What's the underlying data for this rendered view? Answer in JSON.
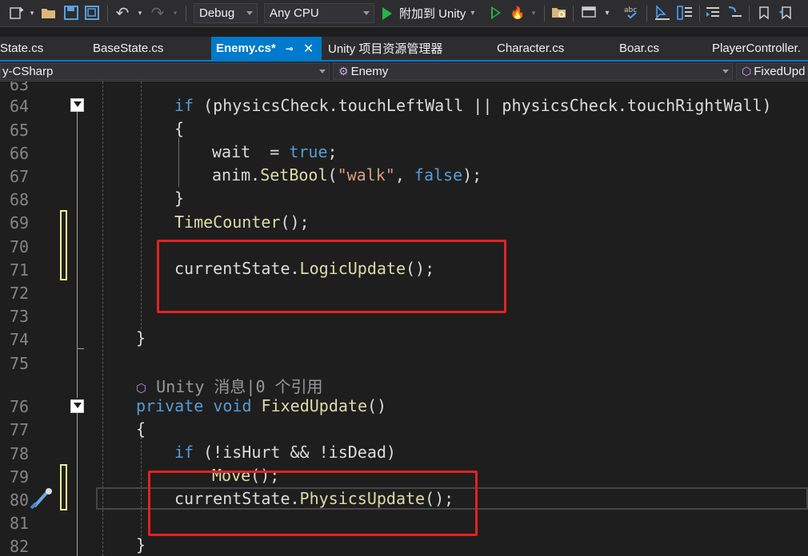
{
  "toolbar": {
    "config": "Debug",
    "platform": "Any CPU",
    "attach": "附加到 Unity"
  },
  "tabs": [
    {
      "label": "State.cs"
    },
    {
      "label": "BaseState.cs"
    },
    {
      "label": "Enemy.cs*",
      "active": true
    },
    {
      "label": "Unity 项目资源管理器"
    },
    {
      "label": "Character.cs"
    },
    {
      "label": "Boar.cs"
    },
    {
      "label": "PlayerController."
    }
  ],
  "nav": {
    "project": "y-CSharp",
    "class": "Enemy",
    "member": "FixedUpd"
  },
  "editor": {
    "line_numbers": [
      "63",
      "64",
      "65",
      "66",
      "67",
      "68",
      "69",
      "70",
      "71",
      "72",
      "73",
      "74",
      "75",
      "76",
      "77",
      "78",
      "79",
      "80",
      "81",
      "82"
    ],
    "codelens": "Unity 消息|0 个引用",
    "colors": {
      "keyword": "#569cd6",
      "method": "#dcdcaa",
      "string": "#d69d85",
      "highlight": "#e32222"
    }
  },
  "code": {
    "l64_if": "if",
    "l64_cond": " (physicsCheck.touchLeftWall || physicsCheck.touchRightWall)",
    "l65": "{",
    "l66_a": "wait  = ",
    "l66_b": "true",
    "l66_c": ";",
    "l67_a": "anim.",
    "l67_b": "SetBool",
    "l67_c": "(",
    "l67_d": "\"walk\"",
    "l67_e": ", ",
    "l67_f": "false",
    "l67_g": ");",
    "l68": "}",
    "l69_a": "TimeCounter",
    "l69_b": "();",
    "l71_a": "currentState.",
    "l71_b": "LogicUpdate",
    "l71_c": "();",
    "l74": "}",
    "l76_a": "private void ",
    "l76_b": "FixedUpdate",
    "l76_c": "()",
    "l77": "{",
    "l78_a": "if",
    "l78_b": " (!isHurt && !isDead)",
    "l79_a": "Move",
    "l79_b": "();",
    "l80_a": "currentState.",
    "l80_b": "PhysicsUpdate",
    "l80_c": "();",
    "l82": "}"
  }
}
